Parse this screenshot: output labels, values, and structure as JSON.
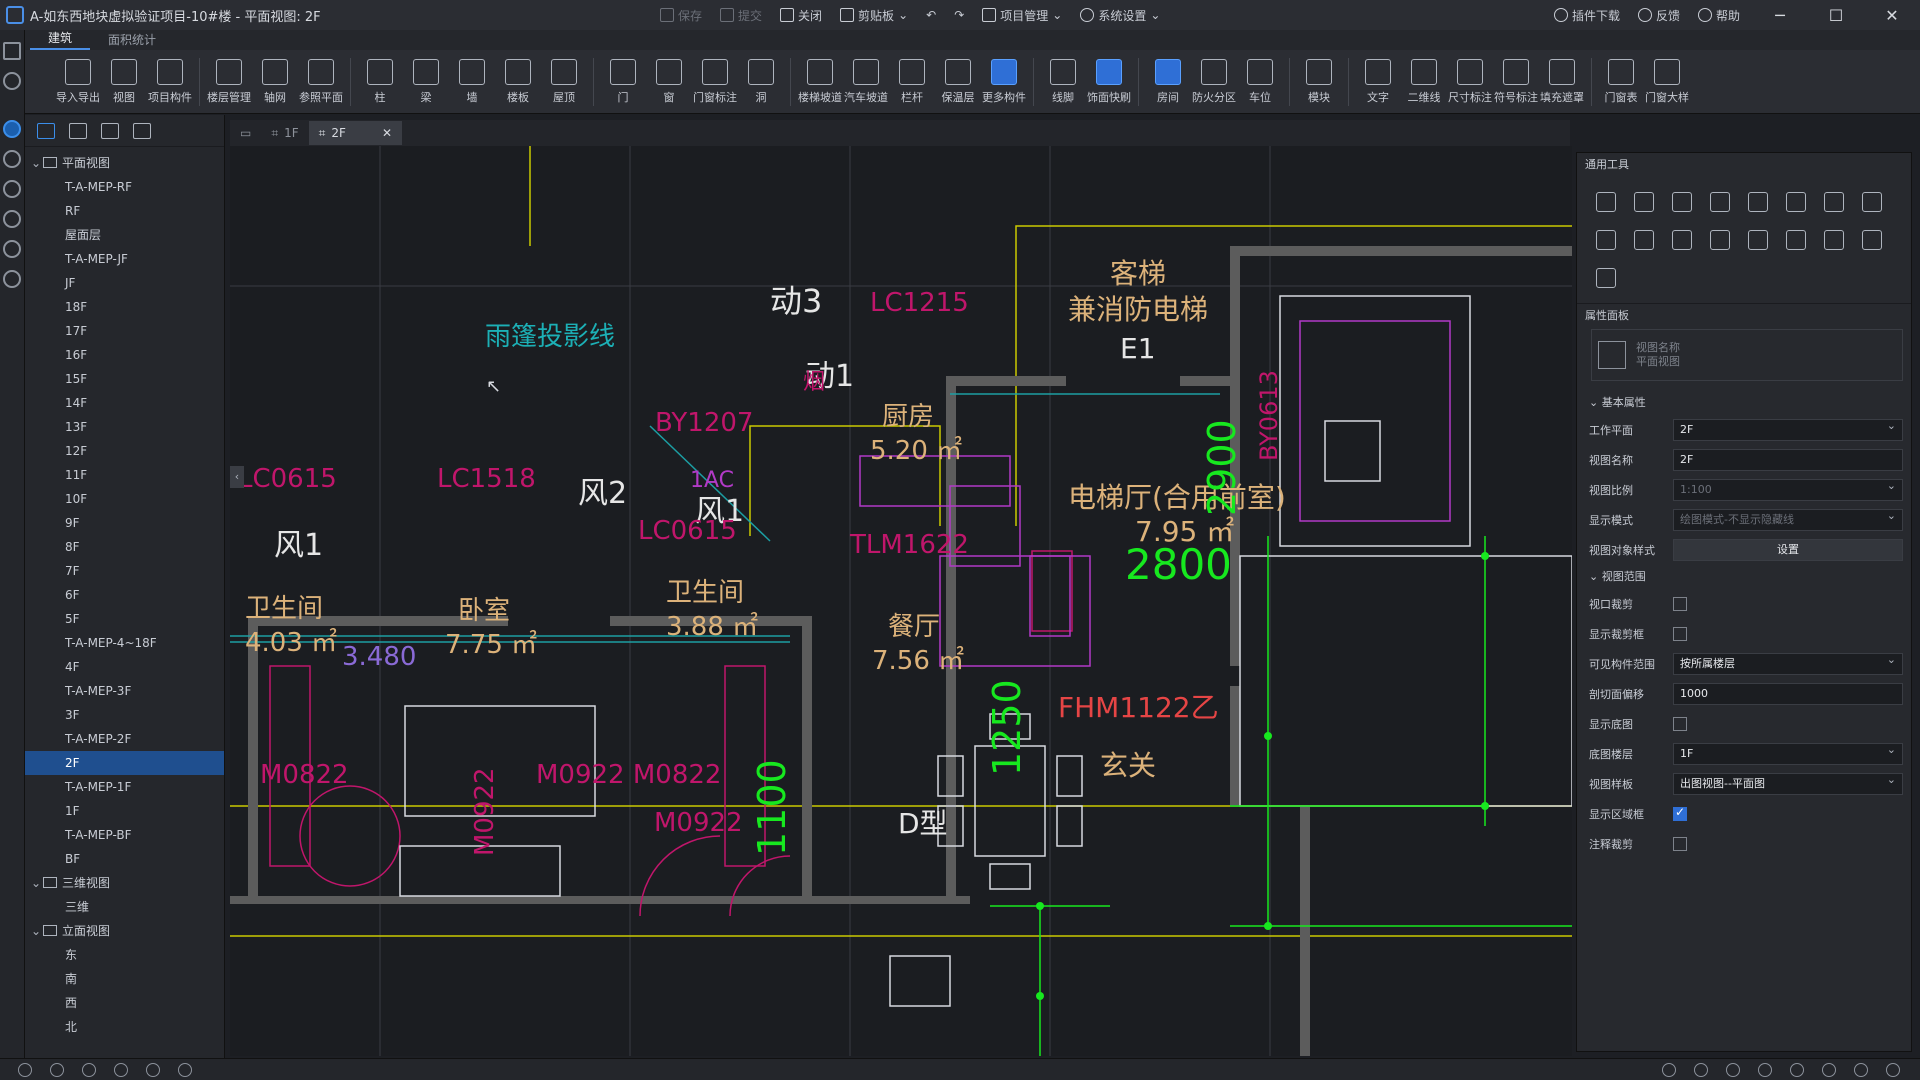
{
  "window": {
    "title": "A-如东西地块虚拟验证项目-10#楼 - 平面视图: 2F"
  },
  "toolbar": {
    "save": "保存",
    "submit": "提交",
    "close": "关闭",
    "clipboard": "剪贴板",
    "project_mgmt": "项目管理",
    "system_settings": "系统设置",
    "plugin_download": "插件下载",
    "feedback": "反馈",
    "help": "帮助"
  },
  "ribbon_tabs": [
    "建筑",
    "面积统计"
  ],
  "ribbon_buttons": [
    {
      "label": "导入导出"
    },
    {
      "label": "视图"
    },
    {
      "label": "项目构件"
    },
    {
      "label": "楼层管理"
    },
    {
      "label": "轴网"
    },
    {
      "label": "参照平面"
    },
    {
      "label": "柱"
    },
    {
      "label": "梁"
    },
    {
      "label": "墙"
    },
    {
      "label": "楼板"
    },
    {
      "label": "屋顶"
    },
    {
      "label": "门"
    },
    {
      "label": "窗"
    },
    {
      "label": "门窗标注"
    },
    {
      "label": "洞"
    },
    {
      "label": "楼梯坡道"
    },
    {
      "label": "汽车坡道"
    },
    {
      "label": "栏杆"
    },
    {
      "label": "保温层"
    },
    {
      "label": "更多构件"
    },
    {
      "label": "线脚"
    },
    {
      "label": "饰面快刷"
    },
    {
      "label": "房间"
    },
    {
      "label": "防火分区"
    },
    {
      "label": "车位"
    },
    {
      "label": "模块"
    },
    {
      "label": "文字"
    },
    {
      "label": "二维线"
    },
    {
      "label": "尺寸标注"
    },
    {
      "label": "符号标注"
    },
    {
      "label": "填充遮罩"
    },
    {
      "label": "门窗表"
    },
    {
      "label": "门窗大样"
    }
  ],
  "tree": {
    "plan_group": "平面视图",
    "plan_items": [
      "T-A-MEP-RF",
      "RF",
      "屋面层",
      "T-A-MEP-JF",
      "JF",
      "18F",
      "17F",
      "16F",
      "15F",
      "14F",
      "13F",
      "12F",
      "11F",
      "10F",
      "9F",
      "8F",
      "7F",
      "6F",
      "5F",
      "T-A-MEP-4~18F",
      "4F",
      "T-A-MEP-3F",
      "3F",
      "T-A-MEP-2F",
      "2F",
      "T-A-MEP-1F",
      "1F",
      "T-A-MEP-BF",
      "BF"
    ],
    "selected": "2F",
    "three_d_group": "三维视图",
    "three_d_items": [
      "三维"
    ],
    "elev_group": "立面视图",
    "elev_items": [
      "东",
      "南",
      "西",
      "北"
    ]
  },
  "view_tabs": [
    {
      "label": "1F",
      "active": false
    },
    {
      "label": "2F",
      "active": true
    }
  ],
  "drawing": {
    "rooms": {
      "kitchen": "厨房",
      "kitchen_area": "5.20 ㎡",
      "elevator": "客梯",
      "elevator_sub": "兼消防电梯",
      "elevator_code": "E1",
      "lobby": "电梯厅(合用前室)",
      "lobby_area": "7.95 ㎡",
      "bath1": "卫生间",
      "bath1_area": "4.03 ㎡",
      "bedroom": "卧室",
      "bedroom_area": "7.75 ㎡",
      "bath2": "卫生间",
      "bath2_area": "3.88 ㎡",
      "dining": "餐厅",
      "dining_area": "7.56 ㎡",
      "foyer": "玄关",
      "type": "D型"
    },
    "labels": {
      "canopy": "雨篷投影线",
      "dong3": "动3",
      "dong1": "动1",
      "feng2": "风2",
      "feng1a": "风1",
      "feng1b": "风1",
      "smoke": "烟",
      "lc1215": "LC1215",
      "by1207": "BY1207",
      "lc0615a": "LC0615",
      "lc1518": "LC1518",
      "lc0615b": "LC0615",
      "iac": "1AC",
      "tlm1622": "TLM1622",
      "fhm1122": "FHM1122乙",
      "m0822a": "M0822",
      "m0922a": "M0922",
      "m0922b": "M0922 M0822",
      "m0922c": "M0922",
      "by0613": "BY0613",
      "dim_3480": "3.480",
      "dim_2800": "2800",
      "dim_2900": "2900",
      "dim_1250": "1250",
      "dim_1100": "1100"
    }
  },
  "tools_panel": {
    "title": "通用工具"
  },
  "properties": {
    "title": "属性面板",
    "view_name_placeholder": "视图名称",
    "view_type_placeholder": "平面视图",
    "basic_section": "基本属性",
    "rows": [
      {
        "label": "工作平面",
        "value": "2F",
        "kind": "select"
      },
      {
        "label": "视图名称",
        "value": "2F",
        "kind": "text"
      },
      {
        "label": "视图比例",
        "value": "1:100",
        "kind": "select-disabled"
      },
      {
        "label": "显示模式",
        "value": "绘图模式-不显示隐藏线",
        "kind": "select-disabled"
      },
      {
        "label": "视图对象样式",
        "value": "设置",
        "kind": "button"
      }
    ],
    "range_section": "视图范围",
    "range_rows": [
      {
        "label": "视口裁剪",
        "kind": "checkbox",
        "checked": false
      },
      {
        "label": "显示裁剪框",
        "kind": "checkbox",
        "checked": false
      },
      {
        "label": "可见构件范围",
        "value": "按所属楼层",
        "kind": "select"
      },
      {
        "label": "剖切面偏移",
        "value": "1000",
        "kind": "text"
      },
      {
        "label": "显示底图",
        "kind": "checkbox",
        "checked": false
      },
      {
        "label": "底图楼层",
        "value": "1F",
        "kind": "select"
      },
      {
        "label": "视图样板",
        "value": "出图视图--平面图",
        "kind": "select"
      },
      {
        "label": "显示区域框",
        "kind": "checkbox",
        "checked": true
      },
      {
        "label": "注释裁剪",
        "kind": "checkbox",
        "checked": false
      }
    ]
  },
  "colors": {
    "accent": "#2f6fd6",
    "wall": "#5c5c5c",
    "magenta": "#c0166b",
    "green": "#17e81f",
    "yellow": "#d8d800"
  }
}
